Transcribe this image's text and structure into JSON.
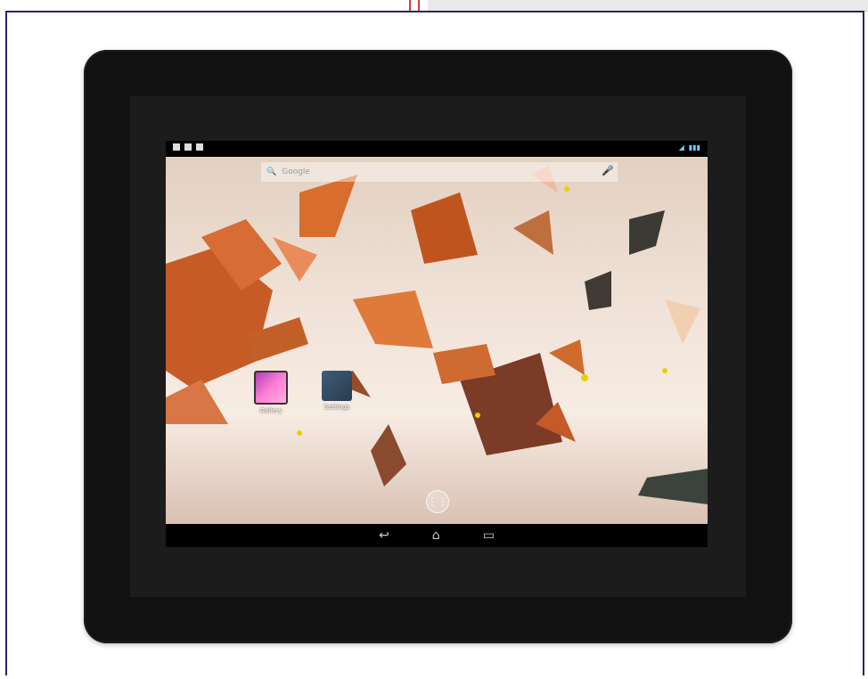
{
  "search": {
    "placeholder": "Google"
  },
  "apps": [
    {
      "label": "Gallery"
    },
    {
      "label": "Settings"
    }
  ],
  "icons": {
    "search": "search-icon",
    "mic": "mic-icon",
    "app_drawer": "apps-icon",
    "back": "back-icon",
    "home": "home-icon",
    "recents": "recent-apps-icon"
  },
  "colors": {
    "bezel": "#111111",
    "screen": "#000000",
    "accent": "#6ec8ff"
  }
}
